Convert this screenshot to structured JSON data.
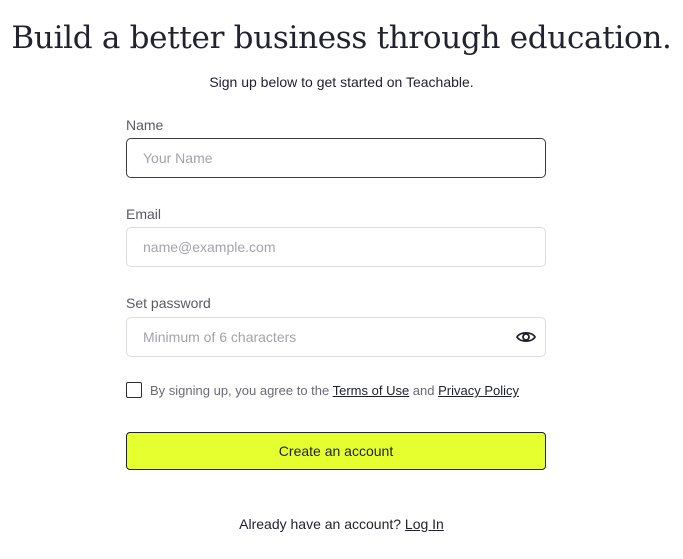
{
  "header": {
    "title": "Build a better business through education.",
    "subtitle": "Sign up below to get started on Teachable."
  },
  "form": {
    "name": {
      "label": "Name",
      "placeholder": "Your Name",
      "value": ""
    },
    "email": {
      "label": "Email",
      "placeholder": "name@example.com",
      "value": ""
    },
    "password": {
      "label": "Set password",
      "placeholder": "Minimum of 6 characters",
      "value": "",
      "toggle_icon": "eye-icon"
    },
    "agreement": {
      "checked": false,
      "prefix": "By signing up, you agree to the ",
      "terms_link": "Terms of Use",
      "conjunction": " and ",
      "privacy_link": "Privacy Policy"
    },
    "submit_label": "Create an account"
  },
  "footer": {
    "prompt": "Already have an account? ",
    "login_link": "Log In"
  },
  "colors": {
    "accent": "#e6ff2e",
    "text": "#1f1f2e",
    "border": "#dcdce2"
  }
}
